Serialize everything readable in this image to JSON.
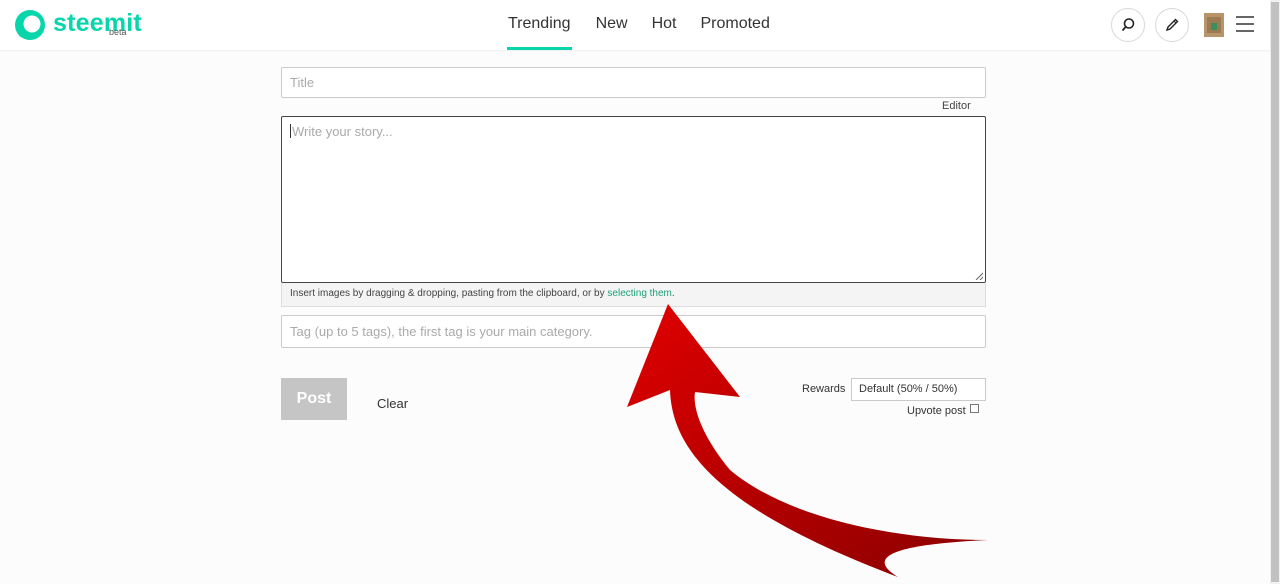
{
  "header": {
    "logo_text": "steemit",
    "logo_badge": "beta",
    "nav": [
      {
        "label": "Trending",
        "active": true
      },
      {
        "label": "New",
        "active": false
      },
      {
        "label": "Hot",
        "active": false
      },
      {
        "label": "Promoted",
        "active": false
      }
    ],
    "icons": [
      "search-icon",
      "pencil-icon",
      "avatar",
      "menu-icon"
    ]
  },
  "form": {
    "title_placeholder": "Title",
    "editor_toggle": "Editor",
    "body_placeholder": "Write your story...",
    "upload_hint": "Insert images by dragging & dropping, pasting from the clipboard, or by ",
    "upload_link": "selecting them",
    "upload_end": ".",
    "tags_placeholder": "Tag (up to 5 tags), the first tag is your main category.",
    "post_label": "Post",
    "clear_label": "Clear",
    "rewards_label": "Rewards",
    "rewards_value": "Default (50% / 50%)",
    "upvote_label": "Upvote post",
    "upvote_checked": false
  },
  "colors": {
    "accent": "#06d6a9",
    "link": "#1a9f77",
    "arrow": "#d10000"
  }
}
